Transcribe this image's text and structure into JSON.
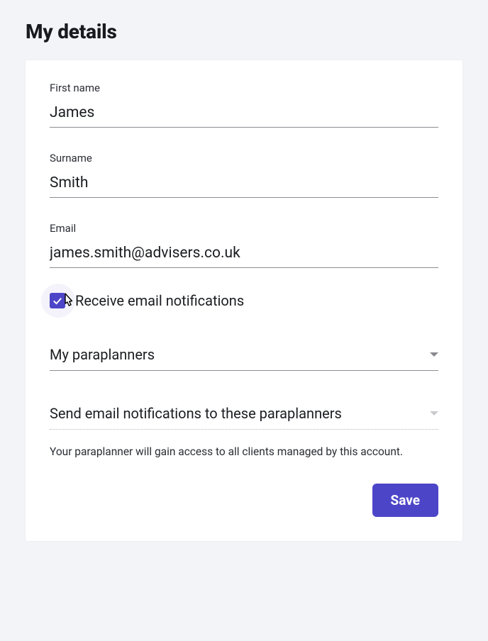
{
  "page": {
    "title": "My details"
  },
  "form": {
    "first_name": {
      "label": "First name",
      "value": "James"
    },
    "surname": {
      "label": "Surname",
      "value": "Smith"
    },
    "email": {
      "label": "Email",
      "value": "james.smith@advisers.co.uk"
    },
    "notifications_checkbox": {
      "label": "Receive email notifications",
      "checked": true
    },
    "paraplanners_select": {
      "label": "My paraplanners"
    },
    "notify_paraplanners_select": {
      "label": "Send email notifications to these paraplanners"
    },
    "helper_text": "Your paraplanner will gain access to all clients managed by this account.",
    "save_label": "Save"
  }
}
